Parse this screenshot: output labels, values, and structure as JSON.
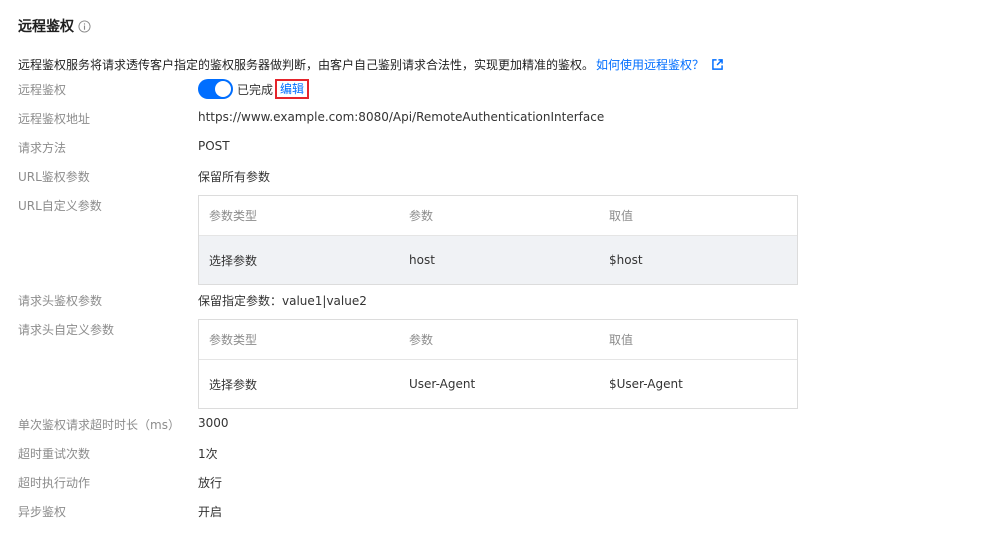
{
  "section": {
    "title": "远程鉴权",
    "description": "远程鉴权服务将请求透传客户指定的鉴权服务器做判断，由客户自己鉴别请求合法性，实现更加精准的鉴权。",
    "help_link": "如何使用远程鉴权？"
  },
  "fields": {
    "remote_auth": {
      "label": "远程鉴权",
      "status": "已完成",
      "edit": "编辑",
      "enabled": true
    },
    "auth_url": {
      "label": "远程鉴权地址",
      "value": "https://www.example.com:8080/Api/RemoteAuthenticationInterface"
    },
    "method": {
      "label": "请求方法",
      "value": "POST"
    },
    "url_params": {
      "label": "URL鉴权参数",
      "value": "保留所有参数"
    },
    "url_custom": {
      "label": "URL自定义参数"
    },
    "header_params": {
      "label": "请求头鉴权参数",
      "value": "保留指定参数：value1|value2"
    },
    "header_custom": {
      "label": "请求头自定义参数"
    },
    "timeout": {
      "label": "单次鉴权请求超时时长（ms）",
      "value": "3000"
    },
    "retries": {
      "label": "超时重试次数",
      "value": "1次"
    },
    "timeout_action": {
      "label": "超时执行动作",
      "value": "放行"
    },
    "async": {
      "label": "异步鉴权",
      "value": "开启"
    }
  },
  "url_table": {
    "headers": [
      "参数类型",
      "参数",
      "取值"
    ],
    "rows": [
      [
        "选择参数",
        "host",
        "$host"
      ]
    ]
  },
  "header_table": {
    "headers": [
      "参数类型",
      "参数",
      "取值"
    ],
    "rows": [
      [
        "选择参数",
        "User-Agent",
        "$User-Agent"
      ]
    ]
  },
  "colors": {
    "accent": "#006eff",
    "highlight_border": "#e5242b"
  }
}
